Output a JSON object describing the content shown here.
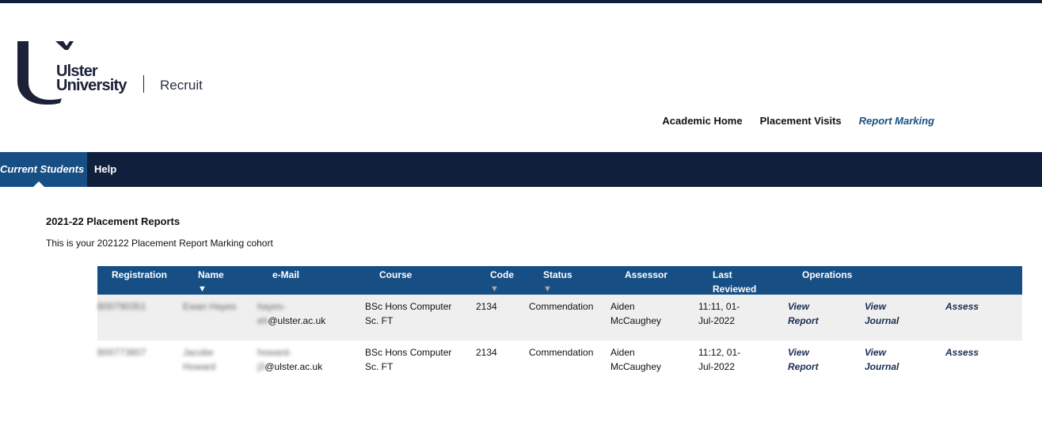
{
  "brand": {
    "line1": "Ulster",
    "line2": "University",
    "app": "Recruit",
    "colors": {
      "logo": "#1b2238",
      "navbar": "#10203c",
      "accent": "#174f85"
    }
  },
  "topnav": {
    "items": [
      {
        "label": "Academic Home"
      },
      {
        "label": "Placement Visits"
      },
      {
        "label": "Report Marking",
        "active": true
      }
    ]
  },
  "navbar": {
    "tabs": [
      {
        "label": "Current Students",
        "active": true
      },
      {
        "label": "Help"
      }
    ]
  },
  "content": {
    "title": "2021-22 Placement Reports",
    "subtitle": "This is your 202122 Placement Report Marking cohort"
  },
  "table": {
    "headers": {
      "registration": "Registration",
      "name": "Name",
      "email": "e-Mail",
      "course": "Course",
      "code": "Code",
      "status": "Status",
      "assessor": "Assessor",
      "last_reviewed_1": "Last",
      "last_reviewed_2": "Reviewed",
      "operations": "Operations"
    },
    "sort_arrow": "▼",
    "rows": [
      {
        "registration": "B00790351",
        "name_1": "Ewan Hayes",
        "name_2": "",
        "email_1": "hayes-",
        "email_blur": "eh",
        "email_domain": "@ulster.ac.uk",
        "course_1": "BSc Hons Computer",
        "course_2": "Sc. FT",
        "code": "2134",
        "status": "Commendation",
        "assessor_1": "Aiden",
        "assessor_2": "McCaughey",
        "reviewed_1": "11:11, 01-",
        "reviewed_2": "Jul-2022",
        "op_view_report_1": "View",
        "op_view_report_2": "Report",
        "op_view_journal_1": "View",
        "op_view_journal_2": "Journal",
        "op_assess": "Assess"
      },
      {
        "registration": "B00773807",
        "name_1": "Jacobe",
        "name_2": "Howard",
        "email_1": "howard-",
        "email_blur": "j3",
        "email_domain": "@ulster.ac.uk",
        "course_1": "BSc Hons Computer",
        "course_2": "Sc. FT",
        "code": "2134",
        "status": "Commendation",
        "assessor_1": "Aiden",
        "assessor_2": "McCaughey",
        "reviewed_1": "11:12, 01-",
        "reviewed_2": "Jul-2022",
        "op_view_report_1": "View",
        "op_view_report_2": "Report",
        "op_view_journal_1": "View",
        "op_view_journal_2": "Journal",
        "op_assess": "Assess"
      }
    ]
  }
}
